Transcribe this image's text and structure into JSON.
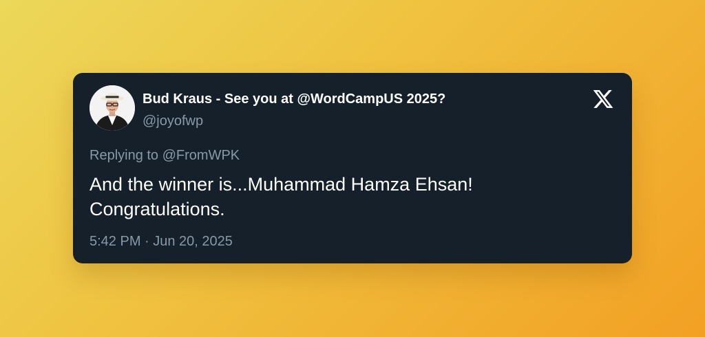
{
  "tweet": {
    "author_name": "Bud Kraus - See you at @WordCampUS 2025?",
    "author_handle": "@joyofwp",
    "reply_prefix": "Replying to",
    "reply_to": "@FromWPK",
    "text_line1": "And the winner is...Muhammad Hamza Ehsan!",
    "text_line2": "Congratulations.",
    "timestamp": "5:42 PM · Jun 20, 2025"
  },
  "icons": {
    "brand": "x-logo-icon",
    "avatar": "avatar"
  },
  "colors": {
    "card_background": "#15202b",
    "primary_text": "#ffffff",
    "secondary_text": "#8b98a5",
    "background_gradient_start": "#ecd85a",
    "background_gradient_end": "#f2a024"
  }
}
